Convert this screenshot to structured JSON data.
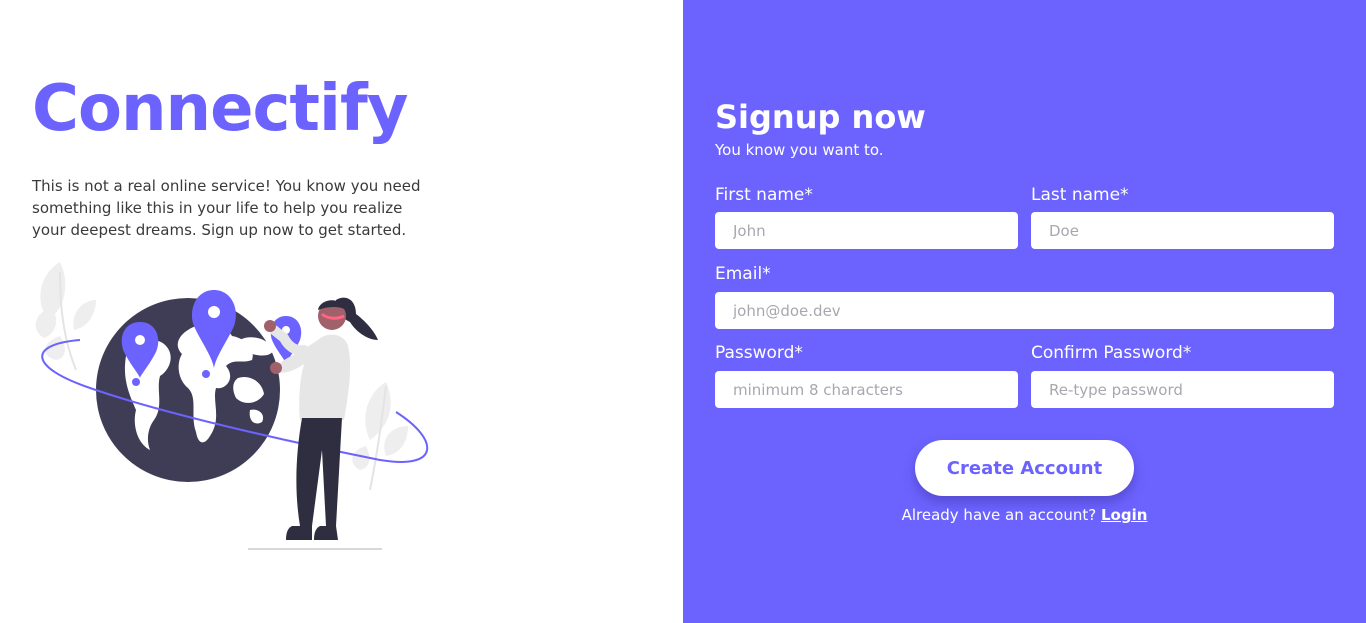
{
  "brand": {
    "name": "Connectify",
    "tagline": "This is not a real online service! You know you need something like this in your life to help you realize your deepest dreams. Sign up now to get started."
  },
  "illustration": {
    "icon": "traveler-globe-illustration",
    "colors": {
      "accent": "#6c63ff",
      "globe": "#3f3d56",
      "land": "#ffffff",
      "leaf": "#f2f2f2"
    }
  },
  "form": {
    "title": "Signup now",
    "subtitle": "You know you want to.",
    "first_name": {
      "label": "First name*",
      "placeholder": "John",
      "value": ""
    },
    "last_name": {
      "label": "Last name*",
      "placeholder": "Doe",
      "value": ""
    },
    "email": {
      "label": "Email*",
      "placeholder": "john@doe.dev",
      "value": ""
    },
    "password": {
      "label": "Password*",
      "placeholder": "minimum 8 characters",
      "value": ""
    },
    "confirm_password": {
      "label": "Confirm Password*",
      "placeholder": "Re-type password",
      "value": ""
    },
    "submit_label": "Create Account",
    "login_prompt": "Already have an account?",
    "login_label": "Login"
  },
  "colors": {
    "accent": "#6c63ff",
    "panel_text": "#ffffff",
    "body_text": "#3a3a3a"
  }
}
